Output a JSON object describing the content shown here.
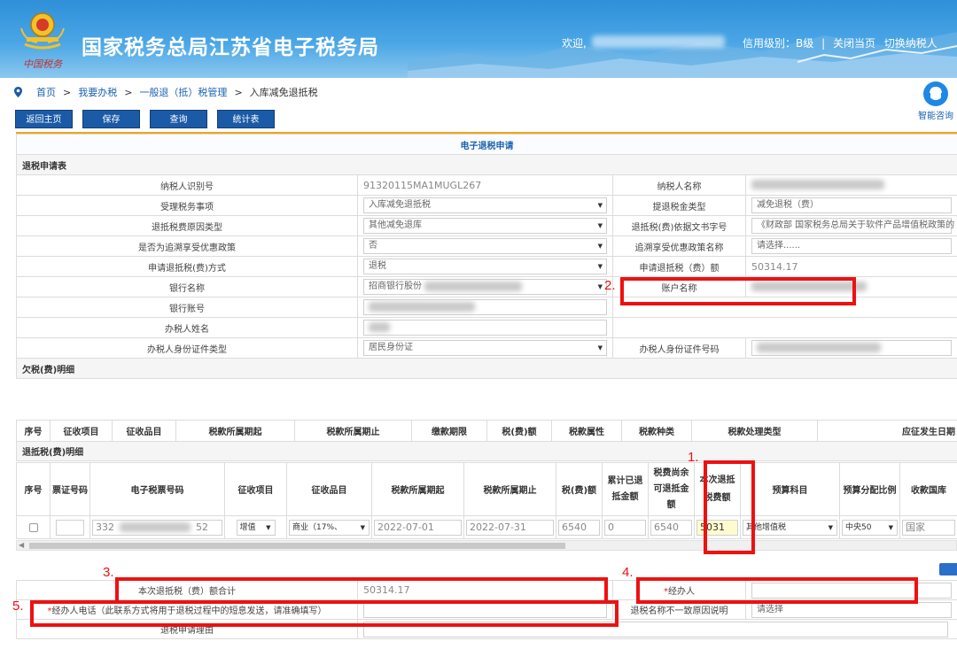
{
  "header": {
    "site_title": "国家税务总局江苏省电子税务局",
    "emblem_text": "中国税务",
    "welcome": "欢迎,",
    "credit": "信用级别：B级",
    "close_page": "关闭当页",
    "switch_taxpayer": "切换纳税人",
    "separator": "|"
  },
  "breadcrumb": {
    "items": [
      "首页",
      "我要办税",
      "一般退（抵）税管理",
      "入库减免退抵税"
    ],
    "sep": ">"
  },
  "help": {
    "label": "智能咨询"
  },
  "buttons": {
    "home": "返回主页",
    "save": "保存",
    "query": "查询",
    "stats": "统计表"
  },
  "form": {
    "title": "电子退税申请",
    "section": "退税申请表",
    "taxpayer_id_label": "纳税人识别号",
    "taxpayer_id": "91320115MA1MUGL267",
    "taxpayer_name_label": "纳税人名称",
    "matter_label": "受理税务事项",
    "matter": "入库减免退抵税",
    "refund_type_label": "提退税金类型",
    "refund_type": "减免退税（费）",
    "reason_label": "退抵税费原因类型",
    "reason": "其他减免退库",
    "doc_label": "退抵税(费)依据文书字号",
    "doc": "《财政部 国家税务总局关于软件产品增值税政策的",
    "retro_label": "是否为追溯享受优惠政策",
    "retro": "否",
    "retro_policy_label": "追溯享受优惠政策名称",
    "retro_policy": "请选择......",
    "method_label": "申请退抵税(费)方式",
    "method": "退税",
    "amount_label": "申请退抵税（费）额",
    "amount": "50314.17",
    "bank_label": "银行名称",
    "bank": "招商银行股份",
    "account_name_label": "账户名称",
    "account_no_label": "银行账号",
    "handler_name_label": "办税人姓名",
    "id_type_label": "办税人身份证件类型",
    "id_type": "居民身份证",
    "id_no_label": "办税人身份证件号码"
  },
  "arrears": {
    "section": "欠税(费)明细",
    "columns": [
      "序号",
      "征收项目",
      "征收品目",
      "税款所属期起",
      "税款所属期止",
      "缴款期限",
      "税(费)额",
      "税款属性",
      "税款种类",
      "税款处理类型",
      "应征发生日期"
    ]
  },
  "refund_detail": {
    "section": "退抵税(费)明细",
    "columns": [
      "序号",
      "票证号码",
      "电子税票号码",
      "征收项目",
      "征收品目",
      "税款所属期起",
      "税款所属期止",
      "税(费)额",
      "累计已退抵金额",
      "税费尚余可退抵金额",
      "本次退抵税费额",
      "预算科目",
      "预算分配比例",
      "收款国库"
    ],
    "row": {
      "ticket_no": "",
      "e_ticket_start": "332",
      "e_ticket_end": "52",
      "item": "增值",
      "category": "商业（17%、",
      "period_start": "2022-07-01",
      "period_end": "2022-07-31",
      "tax_amount": "6540",
      "refunded": "0",
      "remaining": "6540",
      "this_refund": "5031",
      "budget": "其他增值税",
      "ratio": "中央50",
      "treasury": "国家"
    }
  },
  "bottom": {
    "total_label": "本次退抵税（费）额合计",
    "total": "50314.17",
    "handler_label": "经办人",
    "handler_star": "*",
    "phone_label": "经办人电话（此联系方式将用于退税过程中的短息发送，请准确填写）",
    "phone_star": "*",
    "mismatch_label": "退税名称不一致原因说明",
    "mismatch": "请选择",
    "reason_label": "退税申请理由"
  },
  "annotations": [
    "1.",
    "2.",
    "3.",
    "4.",
    "5."
  ],
  "colors": {
    "header": "#2f8fd8",
    "button": "#1b5aa6",
    "accent": "#f5a21b",
    "annotation": "#ee1111"
  }
}
